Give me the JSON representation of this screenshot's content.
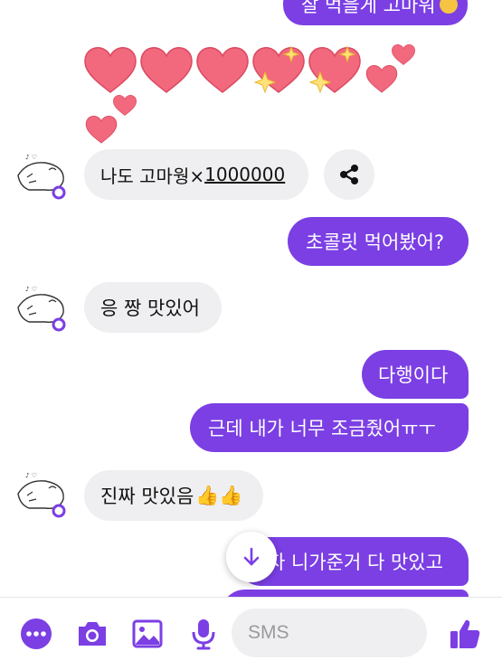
{
  "messages": {
    "top_partial": "잘 먹을게 고마워",
    "m1_text": "나도 고마웡×",
    "m1_number": "1000000",
    "m2": "초콜릿 먹어봤어?",
    "m3": "응 짱 맛있어",
    "m4": "다행이다",
    "m5": "근데 내가 너무 조금줬어ㅠㅜ",
    "m6": "진짜 맛있음",
    "m6_emoji": "👍👍",
    "m7_partial": "자 니가준거 다 맛있고"
  },
  "composer": {
    "placeholder": "SMS"
  },
  "icons": {
    "more": "more-dots-icon",
    "camera": "camera-icon",
    "gallery": "image-icon",
    "mic": "microphone-icon",
    "emoji": "smiley-icon",
    "like": "thumbs-up-icon",
    "share": "share-icon",
    "scroll": "arrow-down-icon"
  },
  "colors": {
    "accent": "#7b3fe4",
    "incoming_bubble": "#efeff1",
    "heart": "#f2687c"
  }
}
